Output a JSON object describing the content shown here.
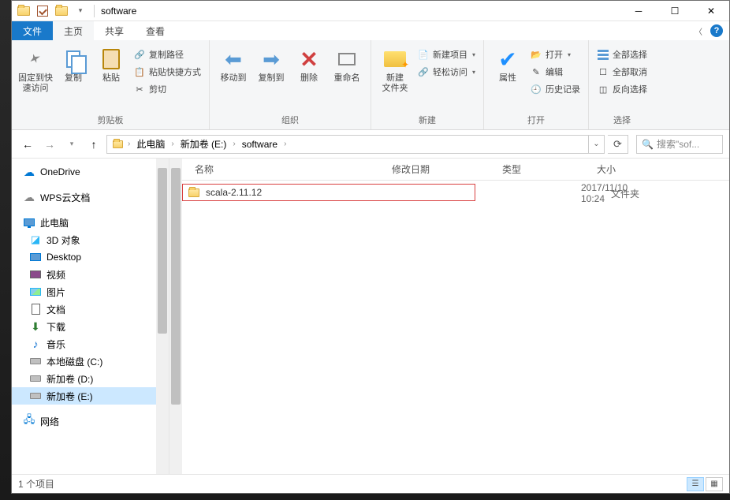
{
  "window": {
    "title": "software"
  },
  "tabs": {
    "file": "文件",
    "home": "主页",
    "share": "共享",
    "view": "查看"
  },
  "ribbon": {
    "clipboard": {
      "pin": "固定到快\n速访问",
      "copy": "复制",
      "paste": "粘贴",
      "copy_path": "复制路径",
      "paste_shortcut": "粘贴快捷方式",
      "cut": "剪切",
      "label": "剪贴板"
    },
    "organize": {
      "move_to": "移动到",
      "copy_to": "复制到",
      "delete": "删除",
      "rename": "重命名",
      "label": "组织"
    },
    "new": {
      "new_folder": "新建\n文件夹",
      "new_item": "新建项目",
      "easy_access": "轻松访问",
      "label": "新建"
    },
    "open": {
      "properties": "属性",
      "open": "打开",
      "edit": "编辑",
      "history": "历史记录",
      "label": "打开"
    },
    "select": {
      "select_all": "全部选择",
      "select_none": "全部取消",
      "invert": "反向选择",
      "label": "选择"
    }
  },
  "breadcrumb": {
    "root": "此电脑",
    "drive": "新加卷 (E:)",
    "folder": "software"
  },
  "search": {
    "placeholder": "搜索\"sof..."
  },
  "sidebar": {
    "onedrive": "OneDrive",
    "wps": "WPS云文档",
    "this_pc": "此电脑",
    "obj3d": "3D 对象",
    "desktop": "Desktop",
    "videos": "视频",
    "pictures": "图片",
    "documents": "文档",
    "downloads": "下载",
    "music": "音乐",
    "drive_c": "本地磁盘 (C:)",
    "drive_d": "新加卷 (D:)",
    "drive_e": "新加卷 (E:)",
    "network": "网络"
  },
  "columns": {
    "name": "名称",
    "modified": "修改日期",
    "type": "类型",
    "size": "大小"
  },
  "files": [
    {
      "name": "scala-2.11.12",
      "modified": "2017/11/10 10:24",
      "type": "文件夹",
      "size": ""
    }
  ],
  "status": {
    "count": "1 个项目"
  }
}
